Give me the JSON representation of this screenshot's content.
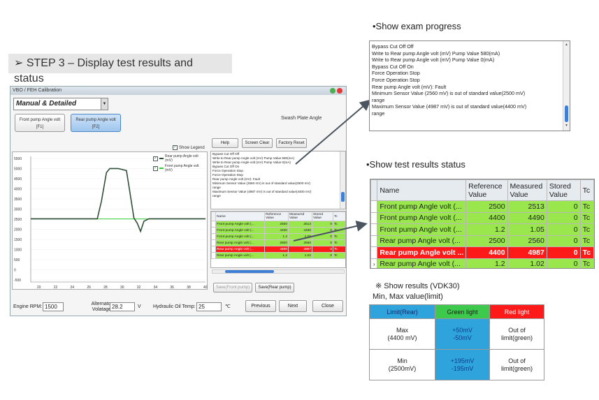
{
  "step": {
    "title": "➢ STEP 3 – Display test results and status"
  },
  "app": {
    "window_title": "VBO / FEH Calibration",
    "mode_select": "Manual & Detailed",
    "function_buttons": [
      {
        "label": "Front pump Angle volt",
        "key": "[F1]"
      },
      {
        "label": "Rear pump Angle volt",
        "key": "[F2]"
      }
    ],
    "swash_label": "Swash Plate Angle",
    "action_buttons": {
      "help": "Help",
      "screen_clear": "Screen Clear",
      "factory_reset": "Factory Reset"
    },
    "show_legend": "Show Legend",
    "legend": [
      "Rear pump Angle volt (mV)",
      "Front pump Angle volt (mV)"
    ],
    "log_lines": [
      "Bypass Cut Off Off",
      "Write to Rear pump Angle volt (mV) Pump Value 580(mA)",
      "Write to Rear pump Angle volt (mV) Pump Value 0(mA)",
      "Bypass Cut Off On",
      "Force Operation Stop",
      "Force Operation Stop",
      "Rear pump Angle volt (mV): Fault",
      "Minimum Sensor Value (2560 mV) is out of standard value(2500 mV)",
      "range",
      "Maximum Sensor Value (4987 mV) is out of standard value(4400 mV)",
      "range"
    ],
    "mini_table": {
      "headers": [
        "Name",
        "Reference Value",
        "Measured Value",
        "Stored Value",
        "Tc"
      ],
      "rows": [
        {
          "name": "Front pump Angle volt (...",
          "ref": "2500",
          "meas": "2513",
          "stored": "0",
          "tc": "Tc",
          "status": "green"
        },
        {
          "name": "Front pump Angle volt (...",
          "ref": "4400",
          "meas": "4490",
          "stored": "0",
          "tc": "Tc",
          "status": "green"
        },
        {
          "name": "Front pump Angle volt (...",
          "ref": "1.2",
          "meas": "1.05",
          "stored": "0",
          "tc": "Tc",
          "status": "green"
        },
        {
          "name": "Rear pump Angle volt (...",
          "ref": "2500",
          "meas": "2560",
          "stored": "0",
          "tc": "Tc",
          "status": "green"
        },
        {
          "name": "Rear pump Angle volt (...",
          "ref": "4400",
          "meas": "4987",
          "stored": "0",
          "tc": "Tc",
          "status": "red"
        },
        {
          "name": "Rear pump Angle volt (...",
          "ref": "1.2",
          "meas": "1.02",
          "stored": "0",
          "tc": "Tc",
          "status": "green"
        }
      ]
    },
    "save_front": "Save(Front pump)",
    "save_rear": "Save(Rear pump)",
    "engine_rpm_label": "Engine RPM:",
    "engine_rpm_value": "1500",
    "alternator_label": "Alternator Volatage:",
    "alternator_value": "28.2",
    "alternator_unit": "V",
    "hydraulic_label": "Hydraulic Oil Temp:",
    "hydraulic_value": "25",
    "hydraulic_unit": "℃",
    "nav": {
      "previous": "Previous",
      "next": "Next",
      "close": "Close"
    },
    "chart": {
      "y_ticks": [
        "5500",
        "5000",
        "4500",
        "4000",
        "3500",
        "3000",
        "2500",
        "2000",
        "1500",
        "1000",
        "500",
        "0",
        "-500"
      ],
      "x_ticks": [
        "20",
        "22",
        "24",
        "26",
        "28",
        "30",
        "32",
        "34",
        "36",
        "38",
        "40"
      ]
    }
  },
  "chart_data": {
    "type": "line",
    "title": "",
    "xlabel": "",
    "ylabel": "",
    "xlim": [
      19,
      40
    ],
    "ylim": [
      -600,
      5600
    ],
    "series": [
      {
        "name": "Rear pump Angle volt (mV)",
        "color": "#2f4f3a",
        "x": [
          19,
          27,
          27.5,
          28.1,
          28.5,
          29.5,
          30.5,
          31.0,
          31.4,
          31.8,
          32.2,
          32.6,
          33.2,
          40
        ],
        "y": [
          2520,
          2520,
          3400,
          4800,
          5000,
          5000,
          4900,
          3600,
          2560,
          2300,
          1900,
          2400,
          2520,
          2520
        ]
      },
      {
        "name": "Front pump Angle volt (mV)",
        "color": "#33cc33",
        "x": [
          19,
          40
        ],
        "y": [
          2513,
          2513
        ]
      }
    ]
  },
  "exam_progress": {
    "heading": "•Show exam progress",
    "lines": [
      "Bypass Cut Off Off",
      "Write to Rear pump Angle volt (mV) Pump Value 580(mA)",
      "Write to Rear pump Angle volt (mV) Pump Value 0(mA)",
      "Bypass Cut Off On",
      "Force Operation Stop",
      "Force Operation Stop",
      "Rear pump Angle volt (mV): Fault",
      "Minimum Sensor Value (2560 mV) is out of standard value(2500 mV)",
      "range",
      "Maximum Sensor Value (4987 mV) is out of standard value(4400 mV)",
      "range"
    ]
  },
  "test_status": {
    "heading": "•Show test results status",
    "headers": [
      "Name",
      "Reference Value",
      "Measured Value",
      "Stored Value",
      "Tc"
    ],
    "rows": [
      {
        "name": "Front pump Angle volt (...",
        "ref": "2500",
        "meas": "2513",
        "stored": "0",
        "tc": "Tc",
        "status": "green",
        "current": false
      },
      {
        "name": "Front pump Angle volt (...",
        "ref": "4400",
        "meas": "4490",
        "stored": "0",
        "tc": "Tc",
        "status": "green",
        "current": false
      },
      {
        "name": "Front pump Angle volt (...",
        "ref": "1.2",
        "meas": "1.05",
        "stored": "0",
        "tc": "Tc",
        "status": "green",
        "current": false
      },
      {
        "name": "Rear pump Angle volt (...",
        "ref": "2500",
        "meas": "2560",
        "stored": "0",
        "tc": "Tc",
        "status": "green",
        "current": false
      },
      {
        "name": "Rear pump Angle volt ...",
        "ref": "4400",
        "meas": "4987",
        "stored": "0",
        "tc": "Tc",
        "status": "red",
        "current": false
      },
      {
        "name": "Rear pump Angle volt (...",
        "ref": "1.2",
        "meas": "1.02",
        "stored": "0",
        "tc": "Tc",
        "status": "green",
        "current": true
      }
    ],
    "current_marker": "›"
  },
  "show_results": {
    "line1": "※  Show results (VDK30)",
    "line2": "Min, Max value(limit)",
    "headers": [
      "Limit(Rear)",
      "Green light",
      "Red light"
    ],
    "rows": [
      {
        "limit": "Max\n(4400 mV)",
        "green": "+50mV\n-50mV",
        "red": "Out of\nlimit(green)"
      },
      {
        "limit": "Min\n(2500mV)",
        "green": "+195mV\n-195mV",
        "red": "Out of\nlimit(green)"
      }
    ]
  }
}
